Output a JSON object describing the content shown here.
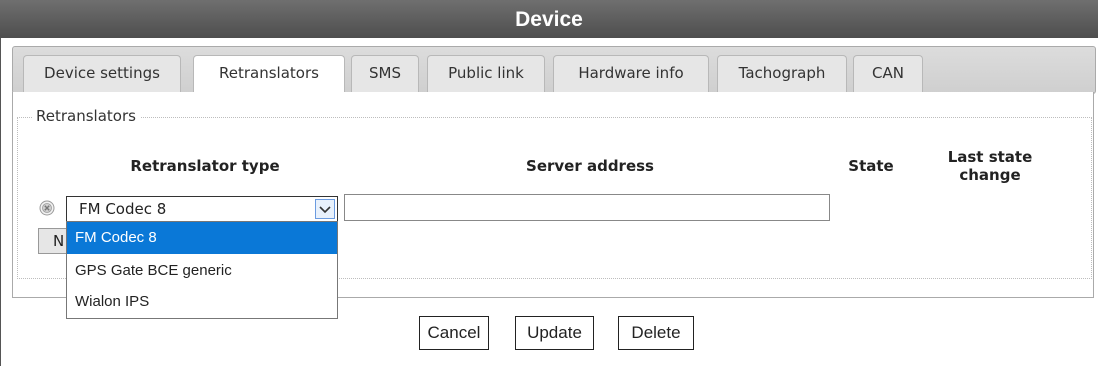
{
  "window": {
    "title": "Device"
  },
  "tabs": [
    {
      "label": "Device settings",
      "active": false
    },
    {
      "label": "Retranslators",
      "active": true
    },
    {
      "label": "SMS",
      "active": false
    },
    {
      "label": "Public link",
      "active": false
    },
    {
      "label": "Hardware info",
      "active": false
    },
    {
      "label": "Tachograph",
      "active": false
    },
    {
      "label": "CAN",
      "active": false
    }
  ],
  "section": {
    "legend": "Retranslators"
  },
  "table": {
    "headers": {
      "type": "Retranslator type",
      "server": "Server address",
      "state": "State",
      "last_change_line1": "Last state",
      "last_change_line2": "change"
    },
    "row": {
      "type_value": "FM Codec 8",
      "server_value": "",
      "remove_icon": "remove-circle-icon"
    }
  },
  "new_button": {
    "label": "N"
  },
  "dropdown": {
    "options": [
      "FM Codec 8",
      "GPS Gate BCE generic",
      "Wialon IPS"
    ],
    "selected": "FM Codec 8"
  },
  "buttons": {
    "cancel": "Cancel",
    "update": "Update",
    "delete": "Delete"
  },
  "colors": {
    "titlebar": "#5a5a5a",
    "selection": "#0a78d7"
  }
}
